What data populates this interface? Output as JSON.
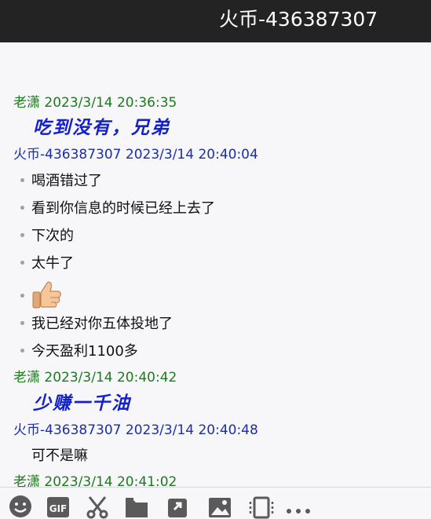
{
  "window": {
    "title": "火币-436387307"
  },
  "messages": [
    {
      "sender": "老潇",
      "time": "2023/3/14 20:36:35",
      "text": "吃到没有，兄弟"
    },
    {
      "sender": "火币-436387307",
      "time": "2023/3/14 20:40:04",
      "lines": [
        "喝酒错过了",
        "看到你信息的时候已经上去了",
        "下次的",
        "太牛了",
        "[thumbs-up-emoji]",
        "我已经对你五体投地了",
        "今天盈利1100多"
      ]
    },
    {
      "sender": "老潇",
      "time": "2023/3/14 20:40:42",
      "text": "少赚一千油"
    },
    {
      "sender": "火币-436387307",
      "time": "2023/3/14 20:40:48",
      "text": "可不是嘛"
    },
    {
      "sender": "老潇",
      "time": "2023/3/14 20:41:02"
    }
  ],
  "toolbar": {
    "icons": [
      "emoji-icon",
      "gif-icon",
      "scissors-icon",
      "folder-icon",
      "shake-icon",
      "image-icon",
      "screen-icon",
      "more-icon"
    ]
  },
  "colors": {
    "titlebar": "#232323",
    "sender_self": "#1d7a1d",
    "sender_other": "#1b2ea8",
    "big_text": "#1420c8"
  }
}
